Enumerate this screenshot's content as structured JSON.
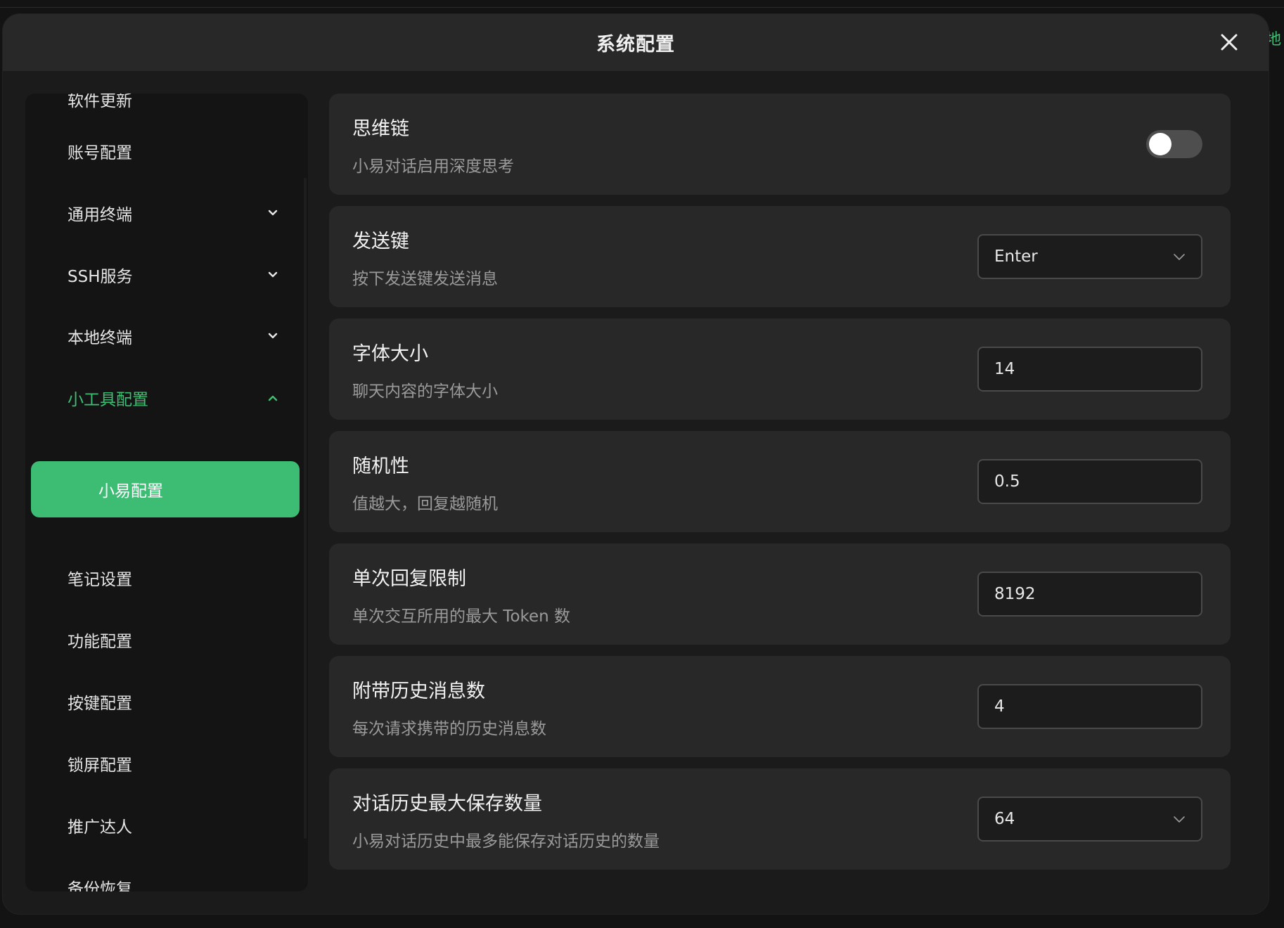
{
  "dialog": {
    "title": "系统配置",
    "close_icon": "close-icon"
  },
  "background": {
    "peek_text": "地"
  },
  "sidebar": {
    "items": [
      {
        "label": "软件更新"
      },
      {
        "label": "账号配置"
      },
      {
        "label": "通用终端",
        "expandable": true,
        "expanded": false
      },
      {
        "label": "SSH服务",
        "expandable": true,
        "expanded": false
      },
      {
        "label": "本地终端",
        "expandable": true,
        "expanded": false
      },
      {
        "label": "小工具配置",
        "expandable": true,
        "expanded": true,
        "active": true
      },
      {
        "label": "小易配置",
        "sub": true,
        "selected": true
      },
      {
        "label": "笔记设置"
      },
      {
        "label": "功能配置"
      },
      {
        "label": "按键配置"
      },
      {
        "label": "锁屏配置"
      },
      {
        "label": "推广达人"
      },
      {
        "label": "备份恢复"
      }
    ]
  },
  "settings": [
    {
      "title": "思维链",
      "description": "小易对话启用深度思考",
      "control": "toggle",
      "value": false
    },
    {
      "title": "发送键",
      "description": "按下发送键发送消息",
      "control": "select",
      "value": "Enter"
    },
    {
      "title": "字体大小",
      "description": "聊天内容的字体大小",
      "control": "input",
      "value": "14"
    },
    {
      "title": "随机性",
      "description": "值越大，回复越随机",
      "control": "input",
      "value": "0.5"
    },
    {
      "title": "单次回复限制",
      "description": "单次交互所用的最大 Token 数",
      "control": "input",
      "value": "8192"
    },
    {
      "title": "附带历史消息数",
      "description": "每次请求携带的历史消息数",
      "control": "input",
      "value": "4"
    },
    {
      "title": "对话历史最大保存数量",
      "description": "小易对话历史中最多能保存对话历史的数量",
      "control": "select",
      "value": "64"
    }
  ],
  "colors": {
    "accent": "#3dbd73",
    "card_bg": "#282828",
    "sidebar_bg": "#141414",
    "dialog_bg": "#1b1b1b"
  }
}
